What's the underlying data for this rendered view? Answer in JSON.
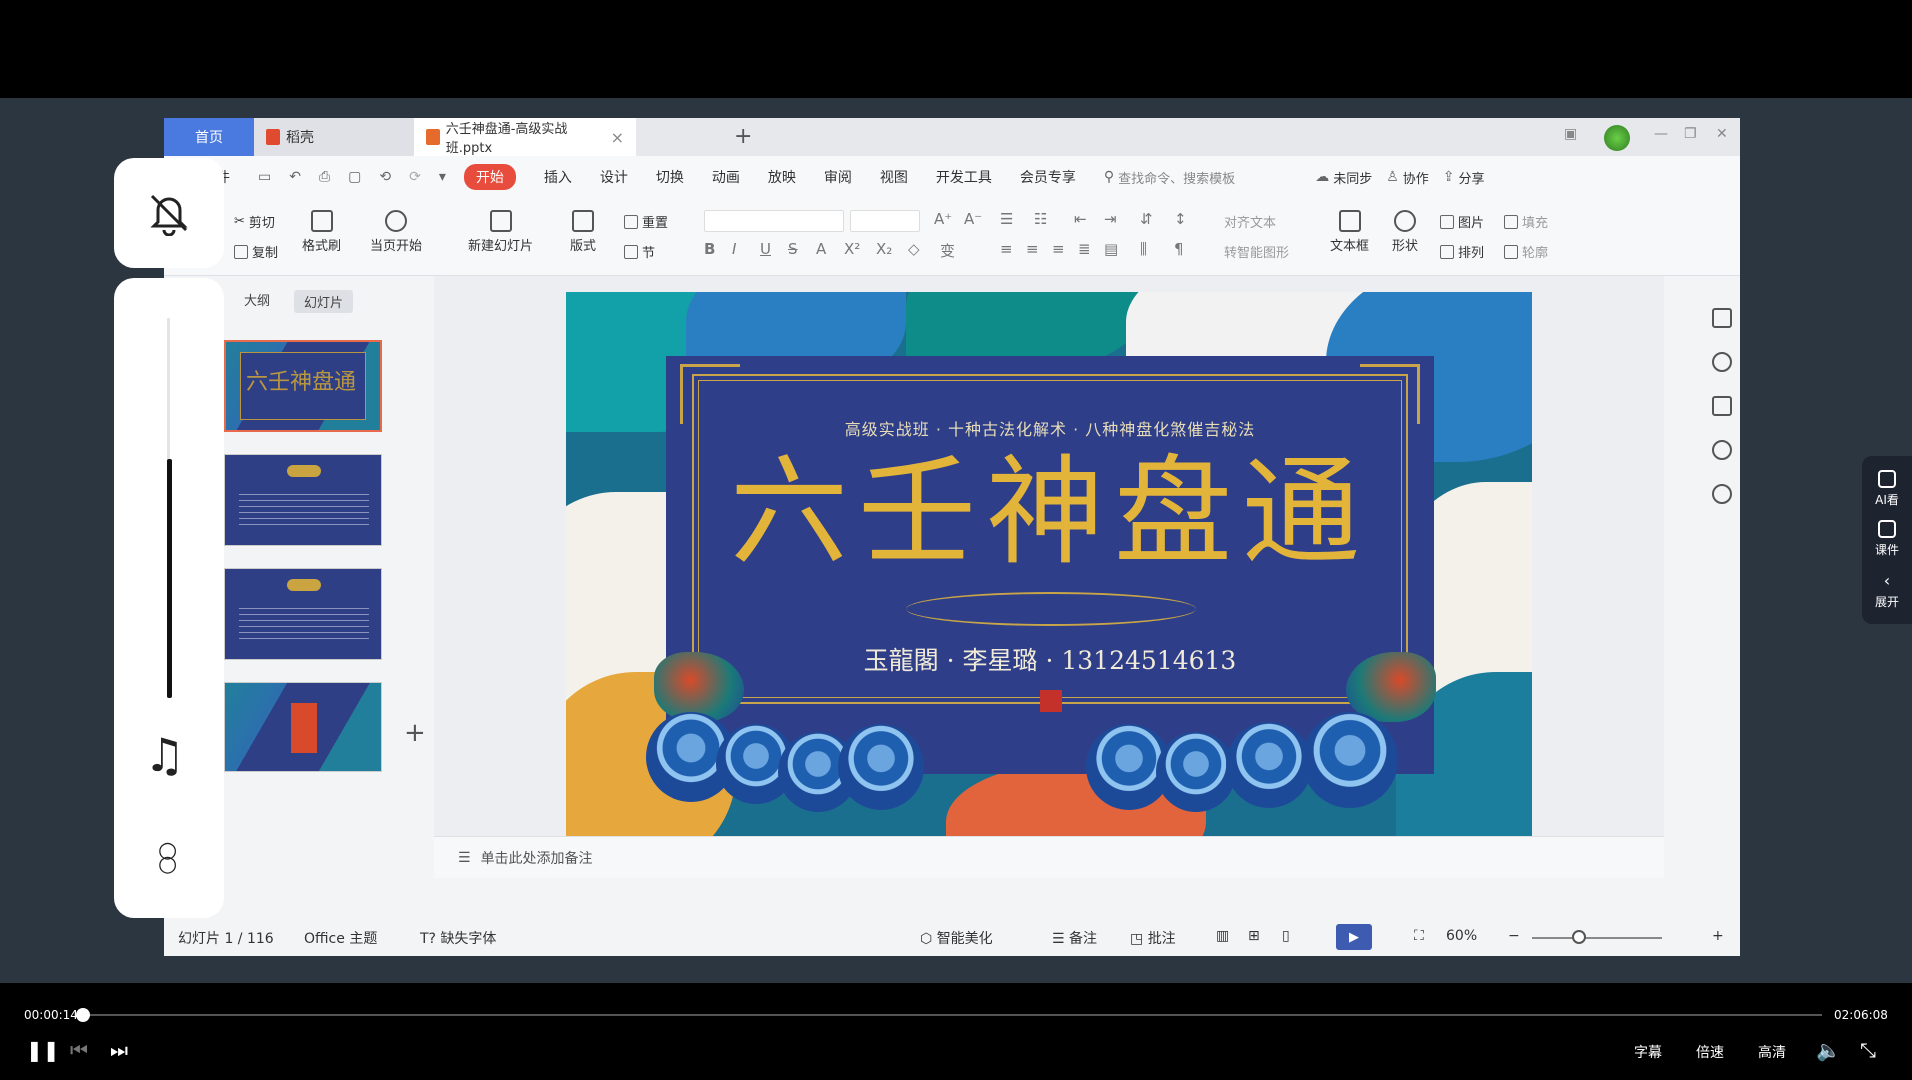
{
  "app": {
    "tabs": [
      {
        "label": "首页"
      },
      {
        "label": "稻壳"
      },
      {
        "label": "六壬神盘通-高级实战班.pptx"
      }
    ],
    "menu": [
      "件",
      "开始",
      "插入",
      "设计",
      "切换",
      "动画",
      "放映",
      "审阅",
      "视图",
      "开发工具",
      "会员专享"
    ],
    "search_placeholder": "查找命令、搜索模板",
    "top_right": [
      "未同步",
      "协作",
      "分享"
    ]
  },
  "ribbon": {
    "cut": "剪切",
    "copy": "复制",
    "format_painter": "格式刷",
    "from_current": "当页开始",
    "new_slide": "新建幻灯片",
    "layout": "版式",
    "section": "节",
    "reset": "重置",
    "align_text": "对齐文本",
    "smartart": "转智能图形",
    "textbox": "文本框",
    "shape": "形状",
    "arrange": "排列",
    "picture": "图片",
    "fill": "填充",
    "outline": "轮廓"
  },
  "panel": {
    "outline_tab": "大纲",
    "slides_tab": "幻灯片"
  },
  "slide": {
    "subtitle": "高级实战班 · 十种古法化解术 · 八种神盘化煞催吉秘法",
    "title": "六壬神盘通",
    "author": "玉龍閣 · 李星璐 · 13124514613"
  },
  "notes_placeholder": "单击此处添加备注",
  "status": {
    "slide_counter": "幻灯片 1 / 116",
    "theme": "Office 主题",
    "missing_font": "缺失字体",
    "beautify": "智能美化",
    "notes": "备注",
    "comments": "批注",
    "zoom": "60%"
  },
  "player": {
    "current_time": "00:00:14",
    "total_time": "02:06:08",
    "progress": 0.002,
    "volume": 0.63,
    "subtitles": "字幕",
    "speed": "倍速",
    "quality": "高清"
  },
  "side_panel": {
    "ai": "AI看",
    "courseware": "课件",
    "expand": "展开"
  },
  "colors": {
    "accent_red": "#e84c3d",
    "slide_navy": "#2f3e88",
    "slide_gold": "#e3b43a",
    "tab_blue": "#4a7ae0"
  }
}
